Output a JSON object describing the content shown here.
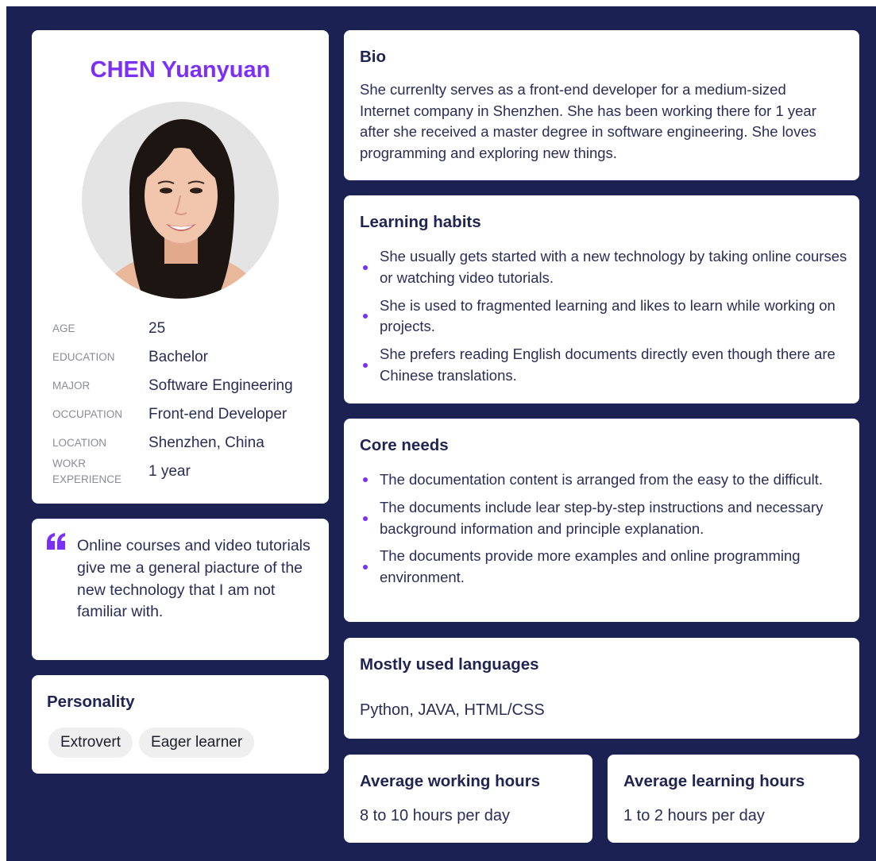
{
  "profile": {
    "name": "CHEN Yuanyuan",
    "facts": [
      {
        "label": "AGE",
        "value": "25"
      },
      {
        "label": "EDUCATION",
        "value": "Bachelor"
      },
      {
        "label": "MAJOR",
        "value": "Software Engineering"
      },
      {
        "label": "OCCUPATION",
        "value": "Front-end Developer"
      },
      {
        "label": "LOCATION",
        "value": "Shenzhen, China"
      },
      {
        "label": "WOKR EXPERIENCE",
        "value": "1 year"
      }
    ]
  },
  "quote": {
    "text": "Online courses and video tutorials give me a general piacture of the new technology that I am not familiar with."
  },
  "personality": {
    "title": "Personality",
    "tags": [
      "Extrovert",
      "Eager learner"
    ]
  },
  "bio": {
    "title": "Bio",
    "text": "She currenlty serves as a front-end developer for a medium-sized Internet company in Shenzhen. She has been working there for 1 year after she received a master degree in software engineering. She loves programming and exploring new things."
  },
  "habits": {
    "title": "Learning habits",
    "items": [
      "She usually gets started with a new technology by taking online courses or watching video tutorials.",
      "She is used to fragmented learning and likes to learn while working on projects.",
      "She prefers reading English documents directly even though there are Chinese translations."
    ]
  },
  "needs": {
    "title": "Core needs",
    "items": [
      "The documentation content is arranged from the easy to the difficult.",
      "The documents include lear step-by-step instructions and necessary background information and principle explanation.",
      "The documents provide more examples and online programming environment."
    ]
  },
  "languages": {
    "title": "Mostly used languages",
    "value": "Python, JAVA, HTML/CSS"
  },
  "work_hours": {
    "title": "Average working hours",
    "value": "8 to 10 hours per day"
  },
  "learn_hours": {
    "title": "Average learning hours",
    "value": "1 to 2 hours per day"
  },
  "colors": {
    "background": "#1c2154",
    "accent": "#7b2ff7",
    "card": "#ffffff",
    "heading": "#1f2452",
    "tag": "#efefef"
  },
  "icons": {
    "quote": "quote-icon",
    "bullet": "bullet-dot"
  }
}
